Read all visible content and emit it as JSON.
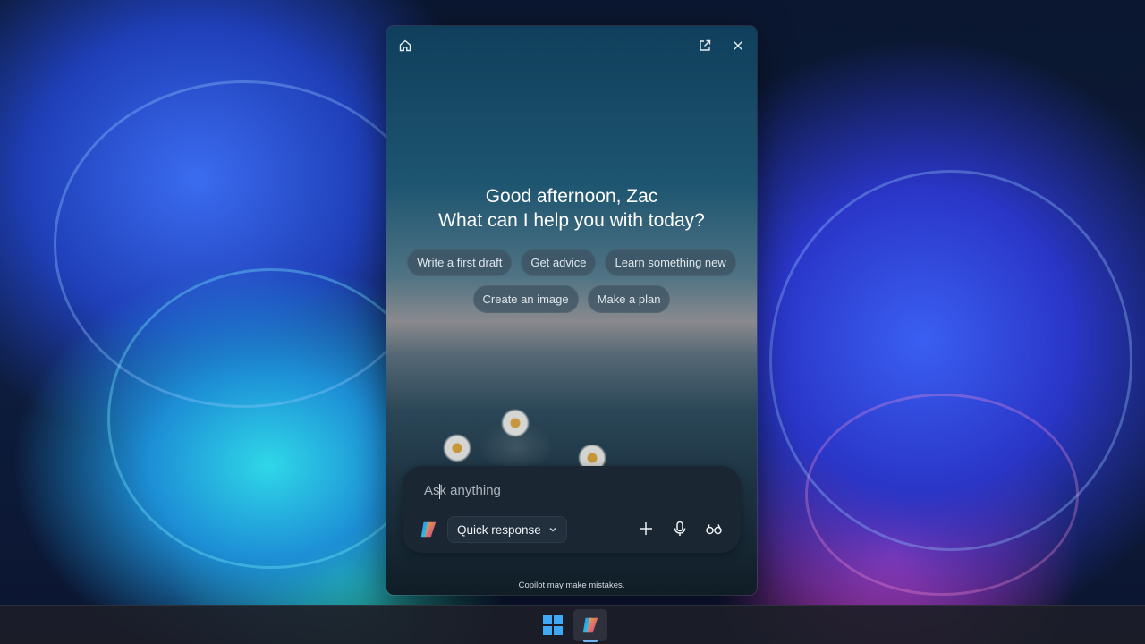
{
  "window": {
    "greeting_line1": "Good afternoon, Zac",
    "greeting_line2": "What can I help you with today?",
    "titlebar_icons": [
      "home-icon",
      "open-external-icon",
      "close-icon"
    ]
  },
  "suggestions": {
    "row1": [
      "Write a first draft",
      "Get advice",
      "Learn something new"
    ],
    "row2": [
      "Create an image",
      "Make a plan"
    ]
  },
  "composer": {
    "placeholder": "Ask anything",
    "value": "",
    "mode": "Quick response",
    "tools": [
      "plus-icon",
      "microphone-icon",
      "vision-glasses-icon"
    ]
  },
  "footer": {
    "disclaimer": "Copilot may make mistakes."
  },
  "taskbar": {
    "items": [
      "windows-start-icon",
      "copilot-icon"
    ],
    "active": "copilot-icon"
  },
  "colors": {
    "accent": "#3fa9f5",
    "chip_bg": "#3c505f",
    "composer_bg": "#1b2633"
  }
}
